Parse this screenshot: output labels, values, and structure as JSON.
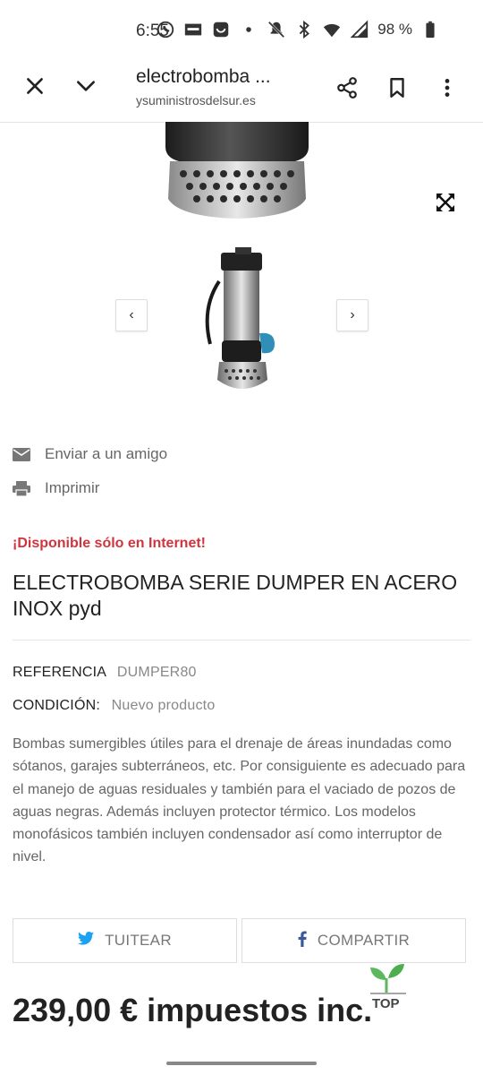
{
  "status_bar": {
    "time": "6:55",
    "battery": "98 %",
    "icons": [
      "whatsapp-icon",
      "sport-icon",
      "app-icon",
      "dot-icon",
      "mute-icon",
      "bluetooth-icon",
      "wifi-icon",
      "signal-icon",
      "battery-icon"
    ]
  },
  "browser": {
    "title": "electrobomba ...",
    "url": "ysuministrosdelsur.es",
    "icons": [
      "close-icon",
      "chevron-down-icon",
      "share-icon",
      "bookmark-icon",
      "more-vert-icon"
    ]
  },
  "actions": {
    "send_friend": "Enviar a un amigo",
    "print": "Imprimir"
  },
  "product": {
    "availability": "¡Disponible sólo en Internet!",
    "title": "ELECTROBOMBA SERIE DUMPER EN ACERO INOX pyd",
    "reference_label": "REFERENCIA",
    "reference_value": "DUMPER80",
    "condition_label": "CONDICIÓN:",
    "condition_value": "Nuevo producto",
    "description": "Bombas sumergibles útiles para el drenaje de áreas inundadas como sótanos, garajes subterráneos, etc. Por consiguiente es adecuado para el manejo de aguas residuales y también para el vaciado de pozos de aguas negras. Además incluyen protector térmico. Los modelos monofásicos también incluyen condensador así como interruptor de nivel.",
    "price": "239,00 € impuestos inc."
  },
  "share": {
    "tweet": "TUITEAR",
    "facebook": "COMPARTIR"
  },
  "back_to_top": "TOP",
  "colors": {
    "availability": "#d0343e",
    "twitter": "#1da1f2",
    "facebook": "#3b5998",
    "top_leaf": "#5cb85c"
  }
}
